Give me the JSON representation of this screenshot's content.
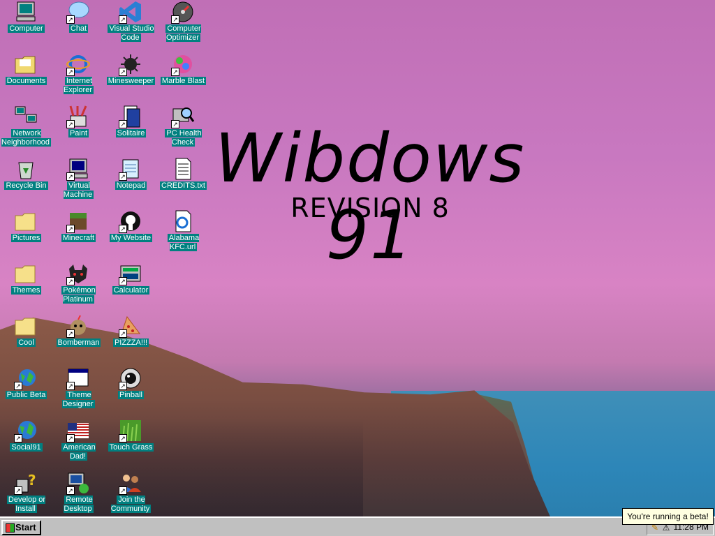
{
  "desktop": {
    "title": "Wibdows 91",
    "subtitle": "REVISION 8",
    "icons": [
      {
        "label": "Computer",
        "icon": "computer-icon"
      },
      {
        "label": "Chat",
        "icon": "chat-icon"
      },
      {
        "label": "Visual Studio Code",
        "icon": "vscode-icon"
      },
      {
        "label": "Computer Optimizer",
        "icon": "optimizer-icon"
      },
      {
        "label": "Documents",
        "icon": "documents-folder-icon"
      },
      {
        "label": "Internet Explorer",
        "icon": "internet-explorer-icon"
      },
      {
        "label": "Minesweeper",
        "icon": "minesweeper-icon"
      },
      {
        "label": "Marble Blast",
        "icon": "marble-blast-icon"
      },
      {
        "label": "Network Neighborhood",
        "icon": "network-icon"
      },
      {
        "label": "Paint",
        "icon": "paint-icon"
      },
      {
        "label": "Solitaire",
        "icon": "solitaire-icon"
      },
      {
        "label": "PC Health Check",
        "icon": "pc-health-icon"
      },
      {
        "label": "Recycle Bin",
        "icon": "recycle-bin-icon"
      },
      {
        "label": "Virtual Machine",
        "icon": "virtual-machine-icon"
      },
      {
        "label": "Notepad",
        "icon": "notepad-icon"
      },
      {
        "label": "CREDITS.txt",
        "icon": "text-file-icon"
      },
      {
        "label": "Pictures",
        "icon": "folder-icon"
      },
      {
        "label": "Minecraft",
        "icon": "minecraft-icon"
      },
      {
        "label": "My Website",
        "icon": "github-icon"
      },
      {
        "label": "Alabama KFC.url",
        "icon": "url-file-icon"
      },
      {
        "label": "Themes",
        "icon": "folder-icon"
      },
      {
        "label": "Pokémon Platinum",
        "icon": "pokemon-icon"
      },
      {
        "label": "Calculator",
        "icon": "calculator-icon"
      },
      {
        "label": "Cool",
        "icon": "folder-icon"
      },
      {
        "label": "Bomberman",
        "icon": "bomberman-icon"
      },
      {
        "label": "PIZZZA!!!",
        "icon": "pizza-icon"
      },
      {
        "label": "Public Beta",
        "icon": "public-beta-icon"
      },
      {
        "label": "Theme Designer",
        "icon": "theme-designer-icon"
      },
      {
        "label": "Pinball",
        "icon": "pinball-icon"
      },
      {
        "label": "Social91",
        "icon": "globe-icon"
      },
      {
        "label": "American Dad!",
        "icon": "american-flag-icon"
      },
      {
        "label": "Touch Grass",
        "icon": "grass-icon"
      },
      {
        "label": "Develop or Install",
        "icon": "help-icon"
      },
      {
        "label": "Remote Desktop",
        "icon": "remote-desktop-icon"
      },
      {
        "label": "Join the Community",
        "icon": "community-icon"
      }
    ]
  },
  "taskbar": {
    "start_label": "Start",
    "clock": "11:28 PM",
    "tooltip": "You're running a beta!"
  }
}
